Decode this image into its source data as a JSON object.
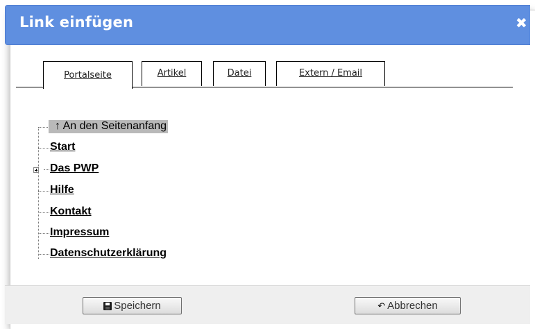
{
  "dialog": {
    "title": "Link einfügen",
    "close_icon": "close-icon",
    "close_glyph": "✖"
  },
  "tabs": [
    {
      "label": "Portalseite",
      "active": true
    },
    {
      "label": "Artikel",
      "active": false
    },
    {
      "label": "Datei",
      "active": false
    },
    {
      "label": "Extern / Email",
      "active": false
    }
  ],
  "tree": {
    "items": [
      {
        "label": "↑ An den Seitenanfang",
        "selected": true
      },
      {
        "label": "Start"
      },
      {
        "label": "Das PWP",
        "expandable": true
      },
      {
        "label": "Hilfe"
      },
      {
        "label": "Kontakt"
      },
      {
        "label": "Impressum"
      },
      {
        "label": "Datenschutzerklärung"
      }
    ]
  },
  "footer": {
    "save_label": "Speichern",
    "save_icon": "floppy-disk-icon",
    "cancel_label": "Abbrechen",
    "cancel_icon": "undo-icon",
    "cancel_glyph": "↶"
  },
  "colors": {
    "titlebar": "#5f8fe0",
    "footer": "#efefef",
    "selection": "#b9b9b9"
  }
}
